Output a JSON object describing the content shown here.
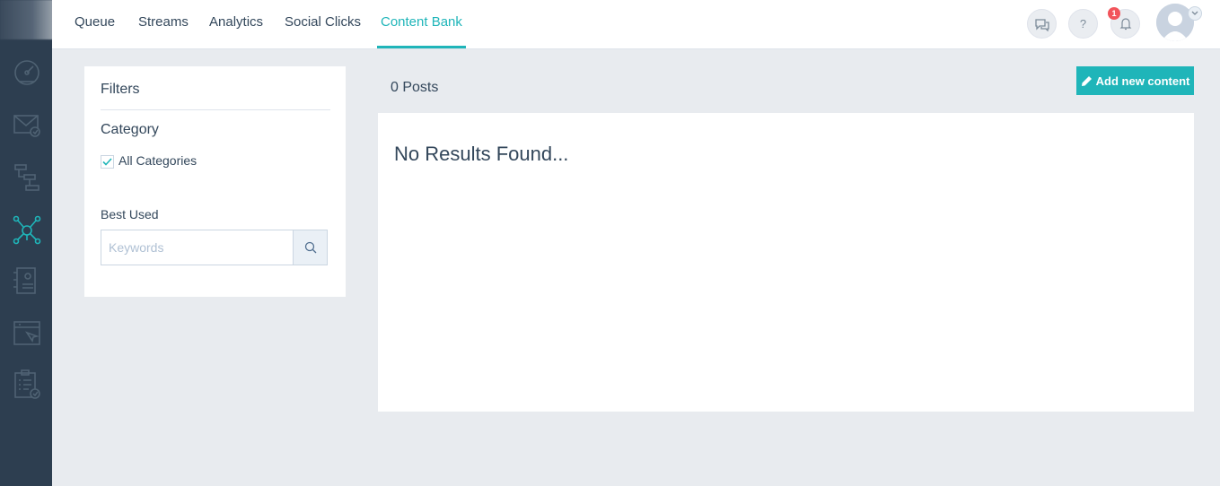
{
  "nav": {
    "tabs": [
      {
        "label": "Queue"
      },
      {
        "label": "Streams"
      },
      {
        "label": "Analytics"
      },
      {
        "label": "Social Clicks"
      },
      {
        "label": "Content Bank",
        "active": true
      }
    ]
  },
  "header": {
    "help_label": "?",
    "notification_count": "1"
  },
  "sidebar": {
    "items": [
      {
        "icon": "dashboard-icon"
      },
      {
        "icon": "email-icon"
      },
      {
        "icon": "workflow-icon"
      },
      {
        "icon": "social-icon",
        "active": true
      },
      {
        "icon": "contacts-icon"
      },
      {
        "icon": "browser-icon"
      },
      {
        "icon": "tasks-icon"
      }
    ]
  },
  "filters": {
    "title": "Filters",
    "category_label": "Category",
    "all_categories_label": "All Categories",
    "all_categories_checked": true,
    "best_used_label": "Best Used",
    "keywords_placeholder": "Keywords"
  },
  "main": {
    "posts_count": "0 Posts",
    "add_button_label": "Add new content",
    "no_results": "No Results Found..."
  },
  "colors": {
    "accent": "#1fb5b9",
    "sidebar_bg": "#2d3e50",
    "page_bg": "#e8ebef",
    "text": "#33475b",
    "badge": "#f2545b"
  }
}
